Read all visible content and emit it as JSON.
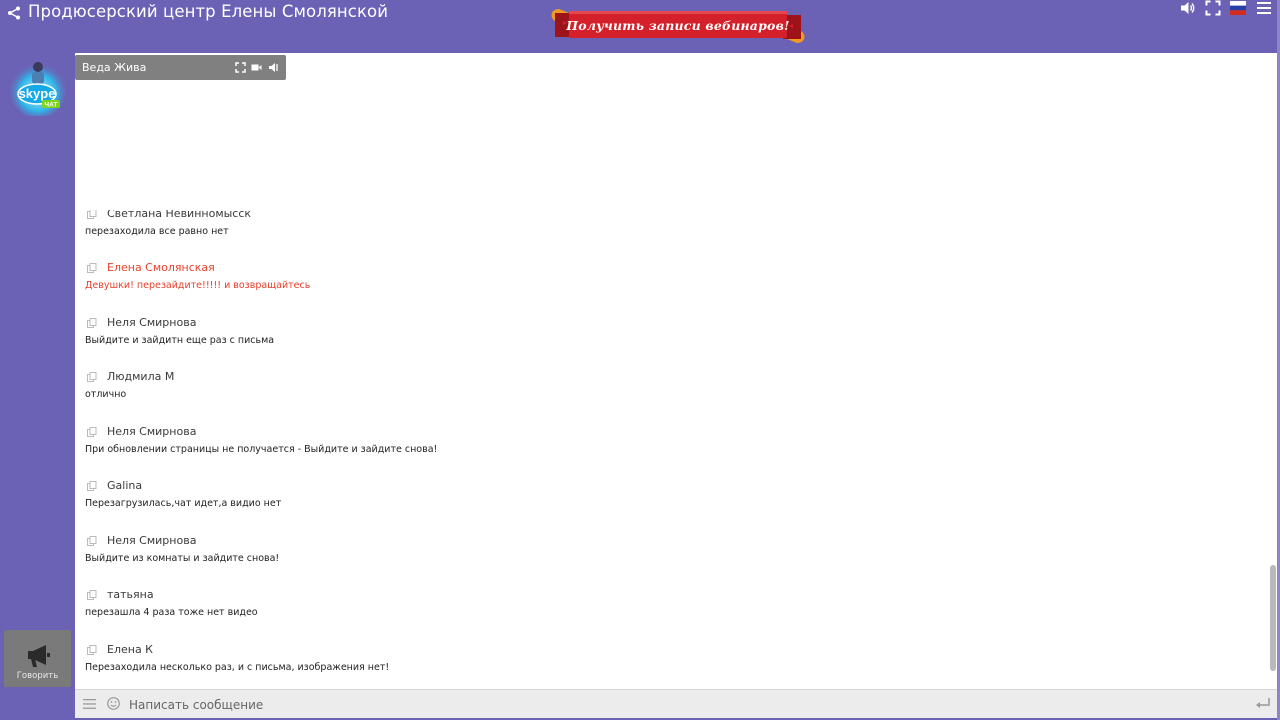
{
  "header": {
    "title": "Продюсерский центр Елены Смолянской",
    "banner_label": "Получить записи вебинаров!",
    "icons": [
      "share-icon",
      "volume-icon",
      "fullscreen-icon",
      "russian-flag-icon",
      "menu-icon"
    ]
  },
  "sidebar": {
    "logo_word": "skype",
    "logo_sub": "ЧАТ",
    "speak_label": "Говорить"
  },
  "video": {
    "name": "Веда Жива",
    "icons": [
      "expand-icon",
      "camera-icon",
      "sound-icon"
    ]
  },
  "chat": {
    "messages": [
      {
        "author": "Светлана Невинномысск",
        "text": "перезаходила все равно нет",
        "admin": false
      },
      {
        "author": "Елена Смолянская",
        "text": "Девушки! перезайдите!!!!! и возвращайтесь",
        "admin": true
      },
      {
        "author": "Неля Смирнова",
        "text": "Выйдите и зайдитн еще раз с письма",
        "admin": false
      },
      {
        "author": "Людмила М",
        "text": "отлично",
        "admin": false
      },
      {
        "author": "Неля Смирнова",
        "text": "При обновлении страницы не получается - Выйдите и зайдите снова!",
        "admin": false
      },
      {
        "author": "Galina",
        "text": "Перезагрузилась,чат идет,а видио нет",
        "admin": false
      },
      {
        "author": "Неля Смирнова",
        "text": "Выйдите из комнаты и зайдите снова!",
        "admin": false
      },
      {
        "author": "татьяна",
        "text": "перезашла 4 раза тоже нет видео",
        "admin": false
      },
      {
        "author": "Елена К",
        "text": "Перезаходила несколько раз, и с письма, изображения нет!",
        "admin": false
      }
    ]
  },
  "input": {
    "placeholder": "Написать сообщение",
    "value": ""
  },
  "colors": {
    "background": "#6b62b5",
    "admin_red": "#e8412c",
    "banner_red": "#d4202a",
    "banner_orange": "#f29a1f"
  }
}
